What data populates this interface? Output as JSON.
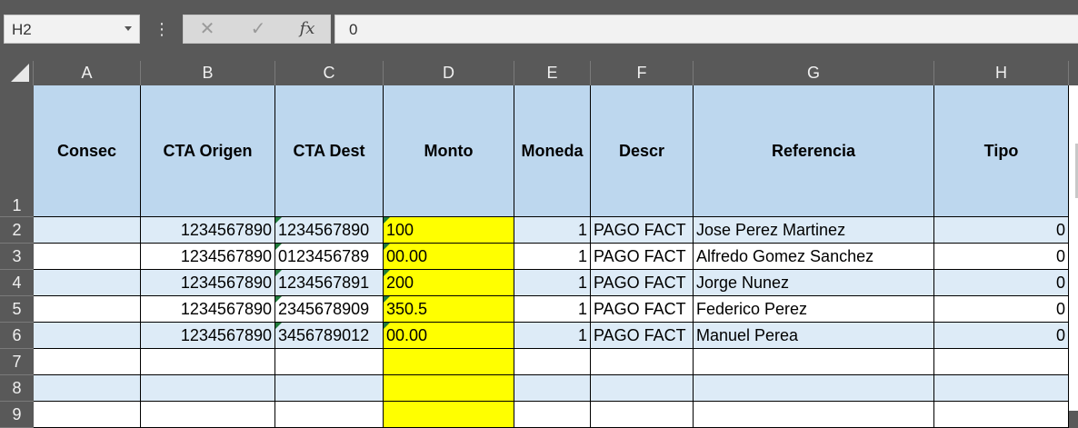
{
  "formula_bar": {
    "name_box": "H2",
    "formula": "0",
    "fx_label": "fx",
    "cancel_glyph": "✕",
    "enter_glyph": "✓",
    "more_glyph": "⋮"
  },
  "colors": {
    "header_fill": "#bdd7ee",
    "band_fill": "#ddebf7",
    "highlight_fill": "#ffff00",
    "error_marker": "#1e7a3a"
  },
  "columns": [
    "A",
    "B",
    "C",
    "D",
    "E",
    "F",
    "G",
    "H"
  ],
  "row_numbers": [
    "1",
    "2",
    "3",
    "4",
    "5",
    "6",
    "7",
    "8",
    "9"
  ],
  "headers": [
    "Consec",
    "CTA Origen",
    "CTA Dest",
    "Monto",
    "Moneda",
    "Descr",
    "Referencia",
    "Tipo"
  ],
  "rows": [
    {
      "consec": "",
      "cta_origen": "1234567890",
      "cta_dest": "1234567890",
      "monto": "100",
      "moneda": "1",
      "descr": "PAGO FACT",
      "referencia": "Jose Perez Martinez",
      "tipo": "0"
    },
    {
      "consec": "",
      "cta_origen": "1234567890",
      "cta_dest": "0123456789",
      "monto": "00.00",
      "moneda": "1",
      "descr": "PAGO FACT",
      "referencia": "Alfredo Gomez Sanchez",
      "tipo": "0"
    },
    {
      "consec": "",
      "cta_origen": "1234567890",
      "cta_dest": "1234567891",
      "monto": "200",
      "moneda": "1",
      "descr": "PAGO FACT",
      "referencia": "Jorge Nunez",
      "tipo": "0"
    },
    {
      "consec": "",
      "cta_origen": "1234567890",
      "cta_dest": "2345678909",
      "monto": "350.5",
      "moneda": "1",
      "descr": "PAGO FACT",
      "referencia": "Federico Perez",
      "tipo": "0"
    },
    {
      "consec": "",
      "cta_origen": "1234567890",
      "cta_dest": "3456789012",
      "monto": "00.00",
      "moneda": "1",
      "descr": "PAGO FACT",
      "referencia": "Manuel Perea",
      "tipo": "0"
    }
  ],
  "blank_rows": 3
}
